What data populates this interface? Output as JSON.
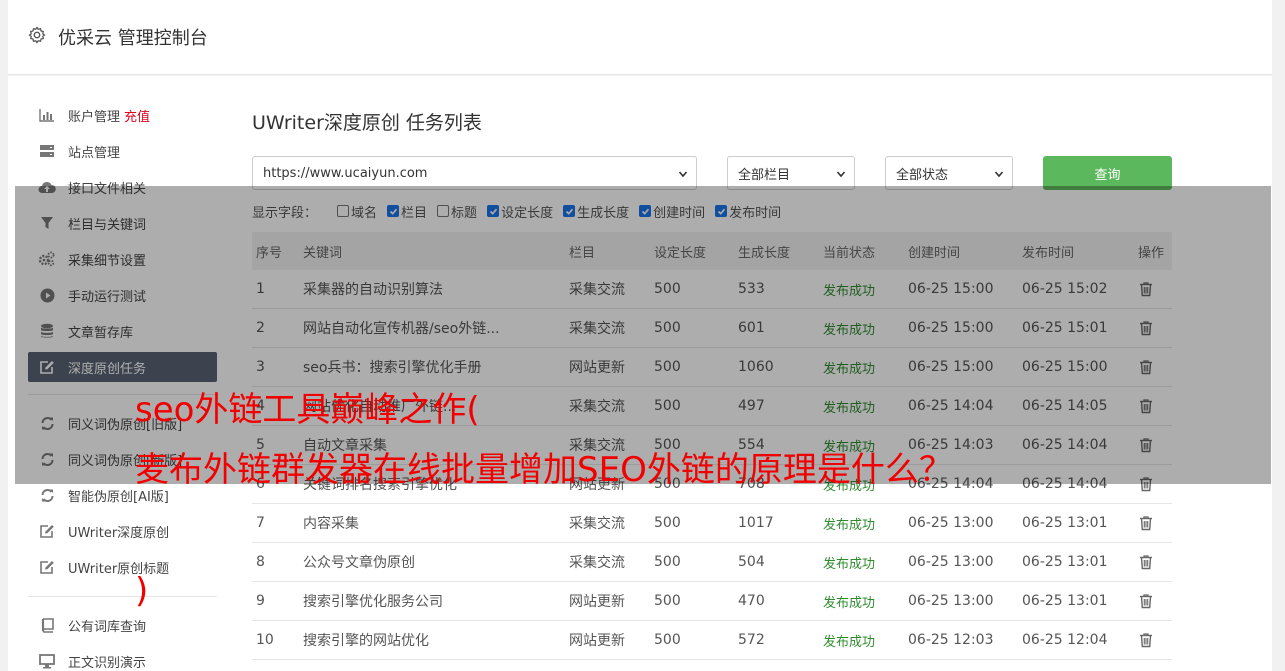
{
  "header": {
    "title": "优采云 管理控制台",
    "icon": "gear-icon"
  },
  "sidebar": {
    "items": [
      {
        "label": "账户管理",
        "extra": "充值",
        "icon": "bar-chart-icon"
      },
      {
        "label": "站点管理",
        "icon": "server-icon"
      },
      {
        "label": "接口文件相关",
        "icon": "cloud-upload-icon"
      },
      {
        "label": "栏目与关键词",
        "icon": "filter-icon"
      },
      {
        "label": "采集细节设置",
        "icon": "gears-icon"
      },
      {
        "label": "手动运行测试",
        "icon": "play-circle-icon"
      },
      {
        "label": "文章暂存库",
        "icon": "database-icon"
      },
      {
        "label": "深度原创任务",
        "icon": "edit-icon",
        "active": true
      },
      {
        "label": "同义词伪原创[旧版]",
        "icon": "refresh-icon"
      },
      {
        "label": "同义词伪原创[新版]",
        "icon": "refresh-icon"
      },
      {
        "label": "智能伪原创[AI版]",
        "icon": "refresh-icon"
      },
      {
        "label": "UWriter深度原创",
        "icon": "edit-icon"
      },
      {
        "label": "UWriter原创标题",
        "icon": "edit-icon"
      },
      {
        "label": "公有词库查询",
        "icon": "book-icon"
      },
      {
        "label": "正文识别演示",
        "icon": "desktop-icon"
      }
    ]
  },
  "main": {
    "title": "UWriter深度原创 任务列表",
    "site_select": "https://www.ucaiyun.com",
    "column_select": "全部栏目",
    "status_select": "全部状态",
    "query_button": "查询",
    "fields_label": "显示字段：",
    "fields": [
      {
        "label": "域名",
        "checked": false
      },
      {
        "label": "栏目",
        "checked": true
      },
      {
        "label": "标题",
        "checked": false
      },
      {
        "label": "设定长度",
        "checked": true
      },
      {
        "label": "生成长度",
        "checked": true
      },
      {
        "label": "创建时间",
        "checked": true
      },
      {
        "label": "发布时间",
        "checked": true
      }
    ],
    "columns": [
      "序号",
      "关键词",
      "栏目",
      "设定长度",
      "生成长度",
      "当前状态",
      "创建时间",
      "发布时间",
      "操作"
    ],
    "rows": [
      [
        "1",
        "采集器的自动识别算法",
        "采集交流",
        "500",
        "533",
        "发布成功",
        "06-25 15:00",
        "06-25 15:02"
      ],
      [
        "2",
        "网站自动化宣传机器/seo外链...",
        "采集交流",
        "500",
        "601",
        "发布成功",
        "06-25 15:00",
        "06-25 15:01"
      ],
      [
        "3",
        "seo兵书：搜索引擎优化手册",
        "网站更新",
        "500",
        "1060",
        "发布成功",
        "06-25 15:00",
        "06-25 15:00"
      ],
      [
        "4",
        "网站优化自动推广外链...",
        "采集交流",
        "500",
        "497",
        "发布成功",
        "06-25 14:04",
        "06-25 14:05"
      ],
      [
        "5",
        "自动文章采集",
        "采集交流",
        "500",
        "554",
        "发布成功",
        "06-25 14:03",
        "06-25 14:04"
      ],
      [
        "6",
        "关键词排名搜索引擎优化",
        "网站更新",
        "500",
        "708",
        "发布成功",
        "06-25 14:04",
        "06-25 14:04"
      ],
      [
        "7",
        "内容采集",
        "采集交流",
        "500",
        "1017",
        "发布成功",
        "06-25 13:00",
        "06-25 13:01"
      ],
      [
        "8",
        "公众号文章伪原创",
        "采集交流",
        "500",
        "504",
        "发布成功",
        "06-25 13:00",
        "06-25 13:01"
      ],
      [
        "9",
        "搜索引擎优化服务公司",
        "网站更新",
        "500",
        "470",
        "发布成功",
        "06-25 13:00",
        "06-25 13:01"
      ],
      [
        "10",
        "搜索引擎的网站优化",
        "网站更新",
        "500",
        "572",
        "发布成功",
        "06-25 12:03",
        "06-25 12:04"
      ]
    ]
  },
  "watermark": {
    "line1": "seo外链工具巅峰之作(",
    "line2": "麦布外链群发器在线批量增加SEO外链的原理是什么？",
    "line3": ")",
    "color": "#f20000"
  }
}
